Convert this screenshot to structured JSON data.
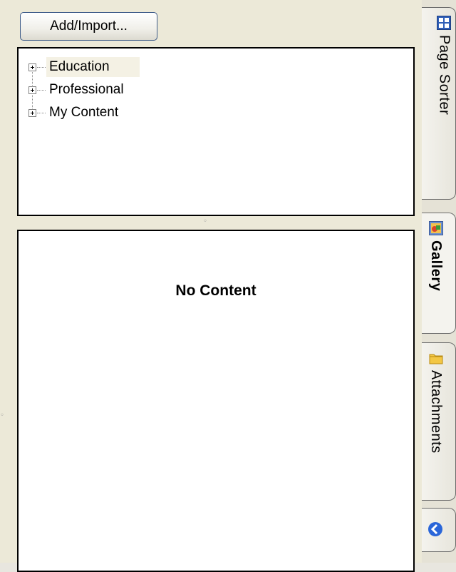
{
  "toolbar": {
    "add_import_label": "Add/Import..."
  },
  "tree": {
    "items": [
      {
        "label": "Education",
        "selected": true
      },
      {
        "label": "Professional",
        "selected": false
      },
      {
        "label": "My Content",
        "selected": false
      }
    ]
  },
  "content": {
    "empty_text": "No Content"
  },
  "tabs": [
    {
      "label": "Page Sorter",
      "icon": "page-sorter-icon",
      "active": false
    },
    {
      "label": "Gallery",
      "icon": "gallery-icon",
      "active": true
    },
    {
      "label": "Attachments",
      "icon": "folder-icon",
      "active": false
    },
    {
      "label": "",
      "icon": "back-arrow-icon",
      "active": false
    }
  ],
  "colors": {
    "accent": "#3c5a88",
    "selection": "#f4f1e4",
    "back_arrow": "#2a66d9"
  }
}
